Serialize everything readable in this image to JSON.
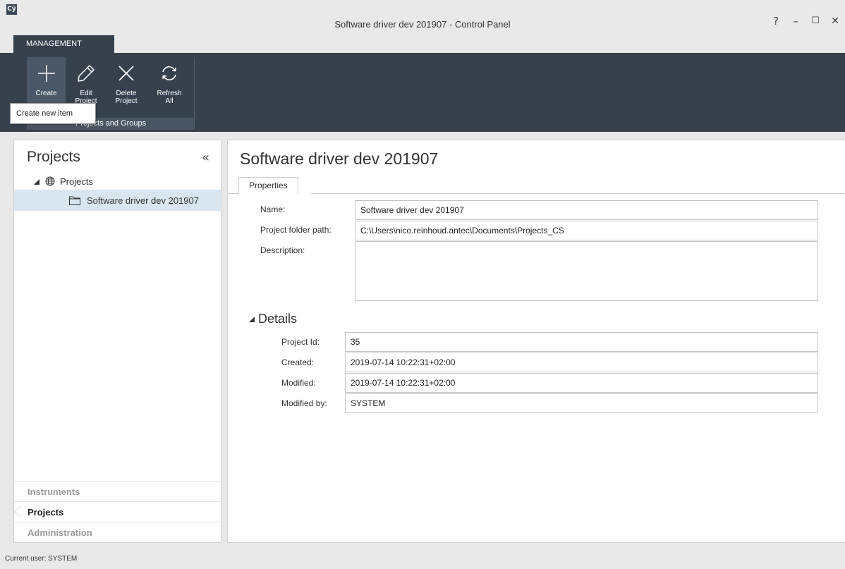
{
  "window": {
    "logo": "Cŷ",
    "title": "Software driver dev 201907 - Control Panel",
    "controls": {
      "help": "?",
      "minimize": "–",
      "maximize": "☐",
      "close": "✕"
    }
  },
  "ribbon": {
    "tab": "MANAGEMENT",
    "buttons": [
      {
        "line1": "Create",
        "line2": "",
        "icon": "plus-icon"
      },
      {
        "line1": "Edit",
        "line2": "Project",
        "icon": "pencil-icon"
      },
      {
        "line1": "Delete",
        "line2": "Project",
        "icon": "x-icon"
      },
      {
        "line1": "Refresh",
        "line2": "All",
        "icon": "refresh-icon"
      }
    ],
    "group_label": "Projects and Groups",
    "tooltip": "Create new item"
  },
  "left_pane": {
    "title": "Projects",
    "collapse": "«",
    "tree_root": "Projects",
    "tree_child": "Software driver dev 201907",
    "nav": [
      "Instruments",
      "Projects",
      "Administration"
    ],
    "nav_current": "Projects"
  },
  "right_pane": {
    "title": "Software driver dev 201907",
    "tab": "Properties",
    "fields": {
      "name_label": "Name:",
      "name_value": "Software driver dev 201907",
      "path_label": "Project folder path:",
      "path_value": "C:\\Users\\nico.reinhoud.antec\\Documents\\Projects_CS",
      "desc_label": "Description:",
      "desc_value": ""
    },
    "details": {
      "header": "Details",
      "id_label": "Project Id:",
      "id_value": "35",
      "created_label": "Created:",
      "created_value": "2019-07-14 10:22:31+02:00",
      "modified_label": "Modified:",
      "modified_value": "2019-07-14 10:22:31+02:00",
      "modified_by_label": "Modified by:",
      "modified_by_value": "SYSTEM"
    }
  },
  "status": {
    "text": "Current user: SYSTEM"
  },
  "colors": {
    "ribbon": "#37414e",
    "selection": "#d9e6f1",
    "active_button": "#4b5868"
  }
}
